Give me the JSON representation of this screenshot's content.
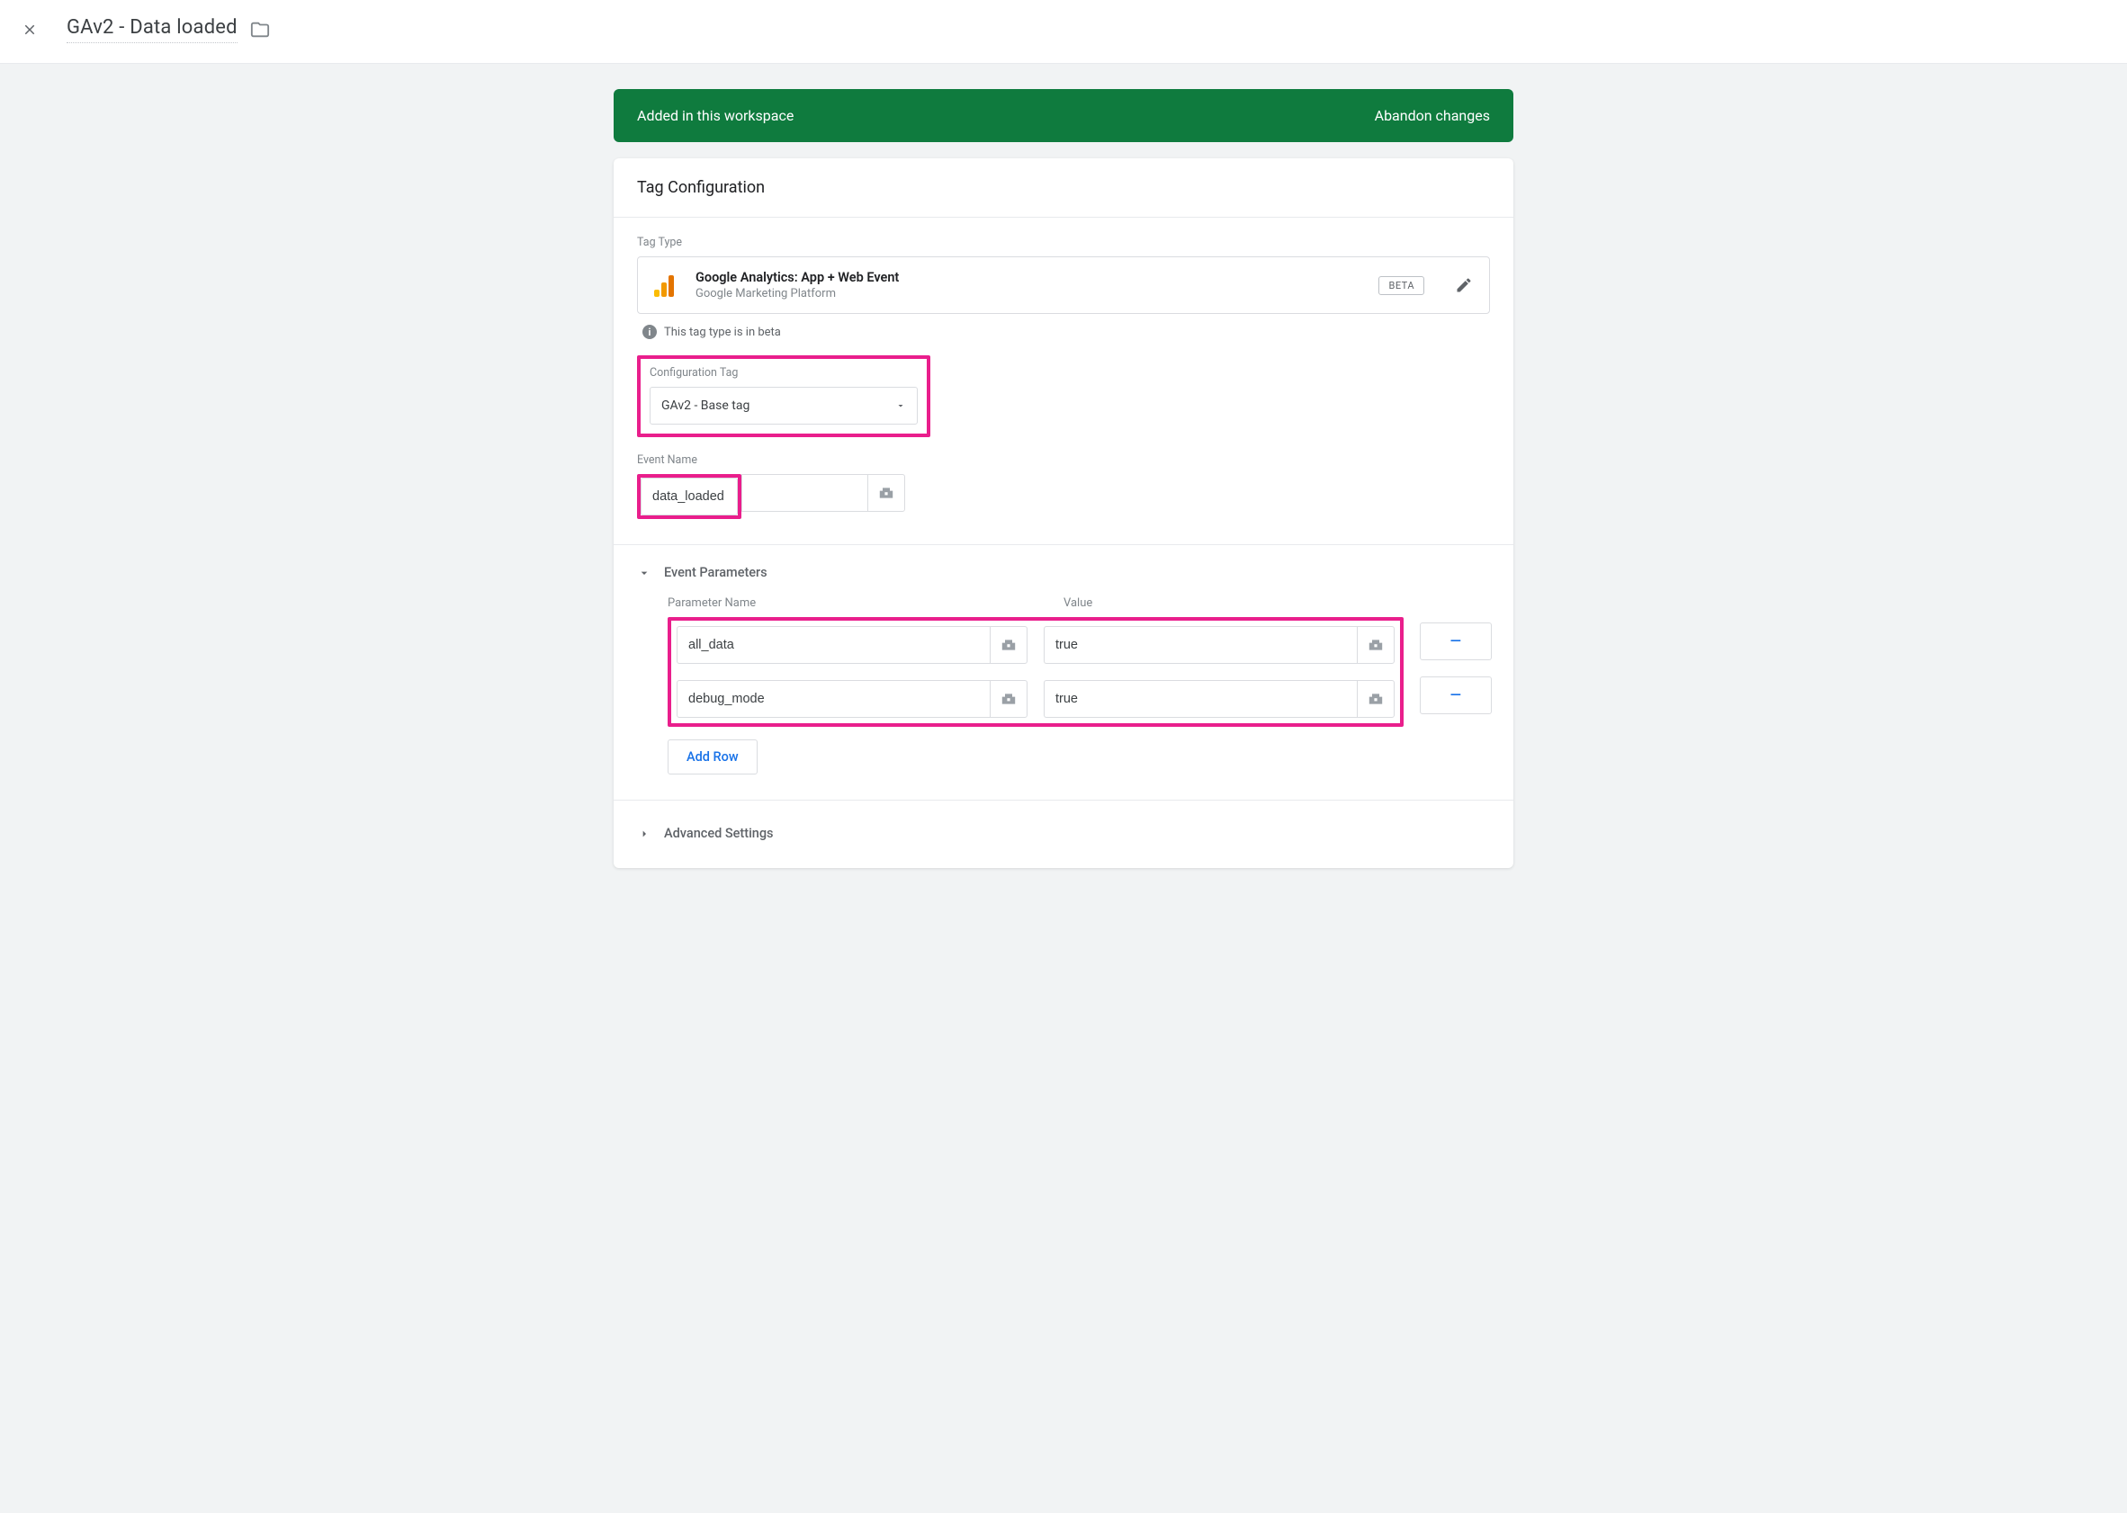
{
  "page_title": "GAv2 - Data loaded",
  "banner": {
    "added_text": "Added in this workspace",
    "abandon_text": "Abandon changes"
  },
  "card": {
    "title": "Tag Configuration",
    "tag_type_label": "Tag Type",
    "tag_type_name": "Google Analytics: App + Web Event",
    "tag_type_platform": "Google Marketing Platform",
    "beta_badge": "BETA",
    "beta_note": "This tag type is in beta",
    "config_tag_label": "Configuration Tag",
    "config_tag_value": "GAv2 - Base tag",
    "event_name_label": "Event Name",
    "event_name_value": "data_loaded",
    "event_params_title": "Event Parameters",
    "param_name_header": "Parameter Name",
    "value_header": "Value",
    "params": [
      {
        "name": "all_data",
        "value": "true"
      },
      {
        "name": "debug_mode",
        "value": "true"
      }
    ],
    "add_row_label": "Add Row",
    "remove_symbol": "–",
    "advanced_title": "Advanced Settings"
  }
}
